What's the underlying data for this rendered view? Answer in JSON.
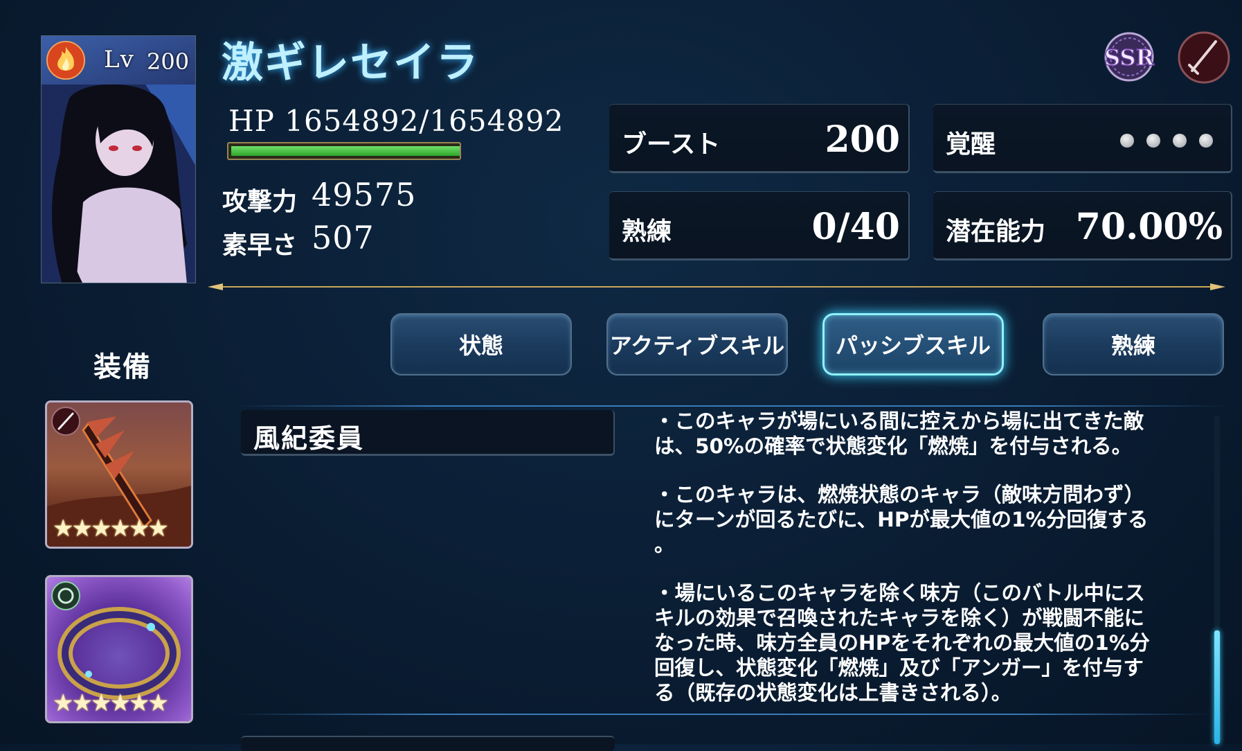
{
  "character": {
    "level_label": "Lv",
    "level": "200",
    "name": "激ギレセイラ",
    "element_icon": "fire-icon",
    "rarity": "SSR",
    "weapon_type_icon": "sword-icon"
  },
  "stats": {
    "hp_text": "HP  1654892/1654892",
    "hp_fraction": 1.0,
    "attack_label": "攻撃力",
    "attack_value": "49575",
    "speed_label": "素早さ",
    "speed_value": "507"
  },
  "boxes": {
    "boost_label": "ブースト",
    "boost_value": "200",
    "awaken_label": "覚醒",
    "awaken_dots": 4,
    "mastery_label": "熟練",
    "mastery_value": "0/40",
    "potential_label": "潜在能力",
    "potential_value": "70.00%"
  },
  "tabs": [
    {
      "label": "状態",
      "active": false
    },
    {
      "label": "アクティブスキル",
      "active": false
    },
    {
      "label": "パッシブスキル",
      "active": true
    },
    {
      "label": "熟練",
      "active": false
    }
  ],
  "equipment": {
    "title": "装備",
    "items": [
      {
        "type_icon": "sword-icon",
        "stars": "★★★★★★"
      },
      {
        "type_icon": "ring-icon",
        "stars": "★★★★★★"
      }
    ]
  },
  "skill": {
    "name": "風紀委員",
    "description": [
      "・このキャラが場にいる間に控えから場に出てきた敵\nは、50%の確率で状態変化「燃焼」を付与される。",
      "・このキャラは、燃焼状態のキャラ（敵味方問わず）\nにターンが回るたびに、HPが最大値の1%分回復する\n。",
      "・場にいるこのキャラを除く味方（このバトル中にス\nキルの効果で召喚されたキャラを除く）が戦闘不能に\nなった時、味方全員のHPをそれぞれの最大値の1%分\n回復し、状態変化「燃焼」及び「アンガー」を付与す\nる（既存の状態変化は上書きされる）。"
    ]
  },
  "colors": {
    "accent": "#8ff2ff",
    "hp_green": "#4fcf4a",
    "background": "#0a1d33"
  }
}
